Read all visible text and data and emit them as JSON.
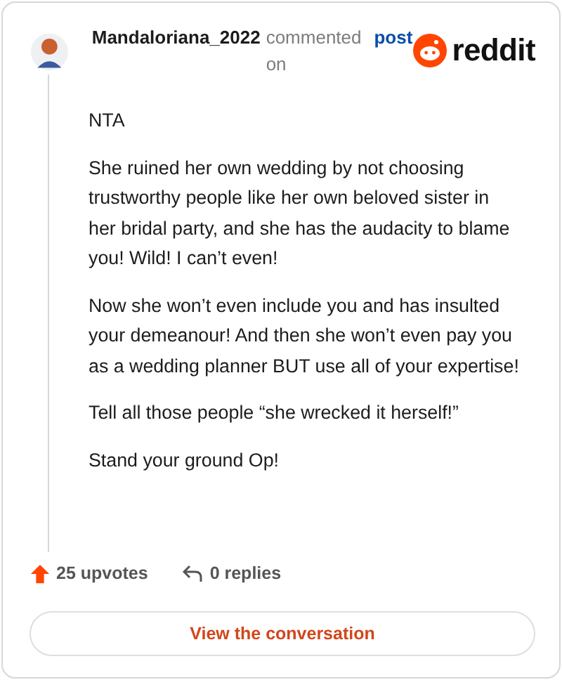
{
  "header": {
    "username": "Mandaloriana_2022",
    "action": "commented on",
    "link": "post",
    "brand": "reddit"
  },
  "comment": {
    "paragraphs": [
      "NTA",
      "She ruined her own wedding by not choosing trustworthy people like her own beloved sister in her bridal party, and she has the audacity to blame you! Wild! I can’t even!",
      "Now she won’t even include you and has insulted your demeanour! And then she won’t even pay you as a wedding planner BUT use all of your expertise!",
      "Tell all those people “she wrecked it herself!”",
      "Stand your ground Op!"
    ]
  },
  "footer": {
    "upvotes": "25 upvotes",
    "replies": "0 replies",
    "button": "View the conversation"
  }
}
